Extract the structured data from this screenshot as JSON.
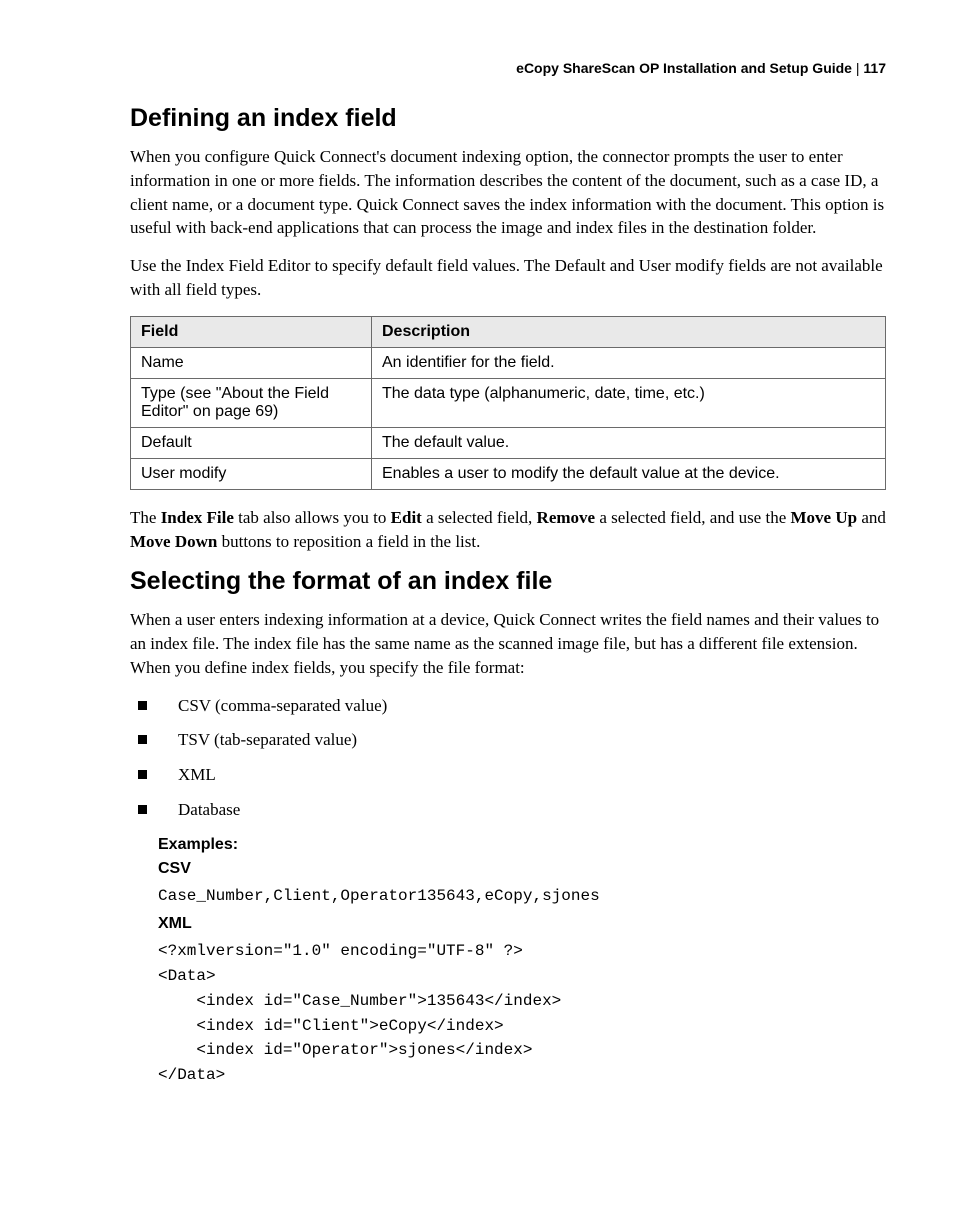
{
  "header": {
    "title": "eCopy ShareScan OP Installation and Setup Guide",
    "separator": " | ",
    "page": "117"
  },
  "section1": {
    "heading": "Defining an index field",
    "para1": "When you configure Quick Connect's document indexing option, the connector prompts the user to enter information in one or more fields. The information describes the content of the document, such as a case ID, a client name, or a document type. Quick Connect saves the index information with the document. This option is useful with back-end applications that can process the image and index files in the destination folder.",
    "para2": "Use the Index Field Editor to specify default field values. The Default and User modify fields are not available with all field types."
  },
  "table": {
    "headers": {
      "field": "Field",
      "desc": "Description"
    },
    "rows": [
      {
        "field": "Name",
        "desc": "An identifier for the field."
      },
      {
        "field": "Type (see \"About the Field Editor\" on page 69)",
        "desc": "The data type (alphanumeric, date, time, etc.)"
      },
      {
        "field": "Default",
        "desc": "The default value."
      },
      {
        "field": "User modify",
        "desc": "Enables a user to modify the default value at the device."
      }
    ]
  },
  "tab_para": {
    "t1": "The ",
    "b1": "Index File",
    "t2": " tab also allows you to ",
    "b2": "Edit",
    "t3": " a selected field, ",
    "b3": "Remove",
    "t4": " a selected field, and use the ",
    "b4": "Move Up",
    "t5": " and ",
    "b5": "Move Down",
    "t6": " buttons to reposition a field in the list."
  },
  "section2": {
    "heading": "Selecting the format of an index file",
    "para1": "When a user enters indexing information at a device, Quick Connect writes the field names and their values to an index file. The index file has the same name as the scanned image file, but has a different file extension. When you define index fields, you specify the file format:"
  },
  "formats": [
    "CSV (comma-separated value)",
    "TSV (tab-separated value)",
    "XML",
    "Database"
  ],
  "examples": {
    "label": "Examples:",
    "csv_label": "CSV",
    "csv_code": "Case_Number,Client,Operator135643,eCopy,sjones",
    "xml_label": "XML",
    "xml_code": "<?xmlversion=\"1.0\" encoding=\"UTF-8\" ?>\n<Data>\n    <index id=\"Case_Number\">135643</index>\n    <index id=\"Client\">eCopy</index>\n    <index id=\"Operator\">sjones</index>\n</Data>"
  }
}
